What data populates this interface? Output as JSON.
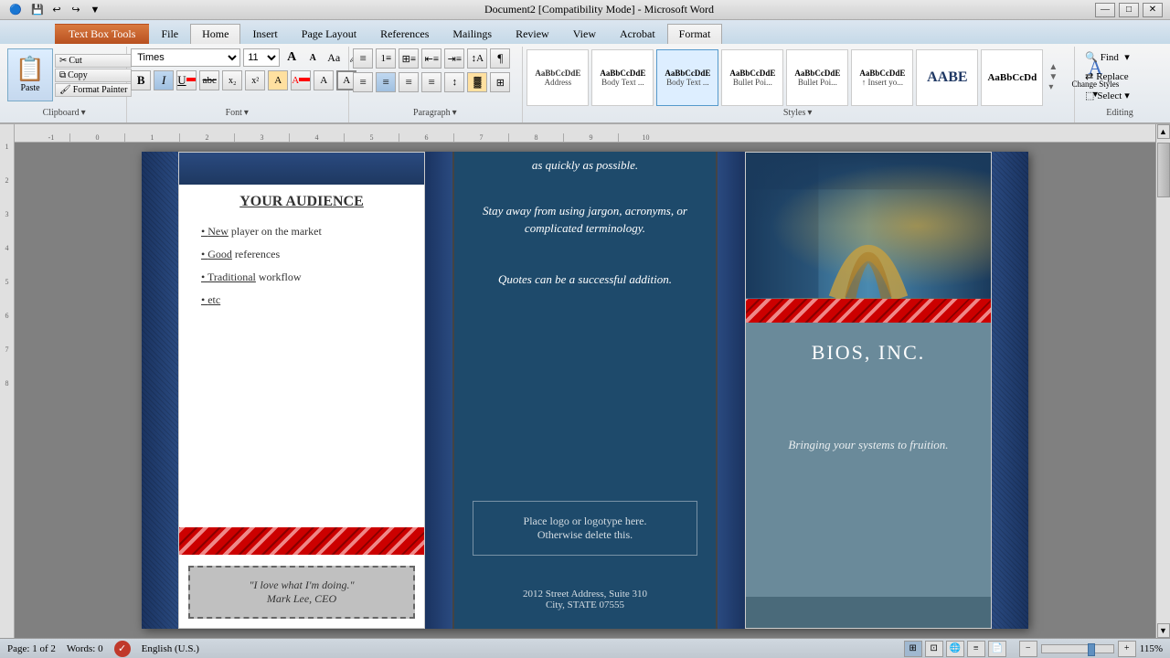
{
  "titlebar": {
    "title": "Document2 [Compatibility Mode] - Microsoft Word",
    "quickaccess": [
      "💾",
      "↩",
      "↪",
      "⬛"
    ],
    "winbtns": [
      "—",
      "□",
      "✕"
    ]
  },
  "ribbon": {
    "textboxtoolslabel": "Text Box Tools",
    "tabs": [
      {
        "id": "file",
        "label": "File"
      },
      {
        "id": "home",
        "label": "Home",
        "active": true
      },
      {
        "id": "insert",
        "label": "Insert"
      },
      {
        "id": "pagelayout",
        "label": "Page Layout"
      },
      {
        "id": "references",
        "label": "References"
      },
      {
        "id": "mailings",
        "label": "Mailings"
      },
      {
        "id": "review",
        "label": "Review"
      },
      {
        "id": "view",
        "label": "View"
      },
      {
        "id": "acrobat",
        "label": "Acrobat"
      },
      {
        "id": "format",
        "label": "Format",
        "formatactive": true
      }
    ],
    "clipboard": {
      "label": "Clipboard",
      "paste_label": "Paste",
      "cut_label": "Cut",
      "copy_label": "Copy",
      "format_painter_label": "Format Painter"
    },
    "font": {
      "label": "Font",
      "font_name": "Times",
      "font_size": "11",
      "bold": "B",
      "italic": "I",
      "underline": "U",
      "strikethrough": "abc",
      "subscript": "x₂",
      "superscript": "x²"
    },
    "paragraph": {
      "label": "Paragraph"
    },
    "styles": {
      "label": "Styles",
      "items": [
        {
          "id": "address",
          "preview": "AaBbCcDdE",
          "label": "Address"
        },
        {
          "id": "bodytext1",
          "preview": "AaBbCcDdE",
          "label": "Body Text ..."
        },
        {
          "id": "bodytext2",
          "preview": "AaBbCcDdE",
          "label": "Body Text ..."
        },
        {
          "id": "bulletpoin1",
          "preview": "AaBbCcDdE",
          "label": "Bullet Poi..."
        },
        {
          "id": "bulletpoin2",
          "preview": "AaBbCcDdE",
          "label": "Bullet Poi..."
        },
        {
          "id": "insertyour",
          "preview": "AaBbCcDdE",
          "label": "↑ Insert yo..."
        },
        {
          "id": "aabe",
          "preview": "AABE",
          "label": ""
        },
        {
          "id": "normal",
          "preview": "AaBbCcDd",
          "label": ""
        }
      ],
      "change_styles_label": "Change Styles",
      "selected_style": "Text , Body"
    },
    "editing": {
      "label": "Editing",
      "find_label": "Find",
      "replace_label": "Replace",
      "select_label": "Select"
    }
  },
  "ruler": {
    "marks": [
      "-1",
      "0",
      "1",
      "2",
      "3",
      "4",
      "5",
      "6",
      "7",
      "8",
      "9",
      "10"
    ]
  },
  "document": {
    "panel1": {
      "heading": "YOUR AUDIENCE",
      "bullets": [
        {
          "text": "New",
          "rest": " player on the market"
        },
        {
          "text": "Good",
          "rest": " references"
        },
        {
          "text": "Traditional",
          "rest": " workflow"
        },
        {
          "text": "etc",
          "rest": ""
        }
      ],
      "quote": "\"I love what I'm doing.\" Mark Lee, CEO"
    },
    "panel2": {
      "text1": "as quickly as possible.",
      "text2": "Stay away from using jargon, acronyms, or complicated terminology.",
      "text3": "Quotes can be a successful addition.",
      "logo_text": "Place logo  or logotype here.\nOtherwise delete this.",
      "address1": "2012 Street Address,  Suite 310",
      "address2": "City, STATE 07555"
    },
    "panel3": {
      "company": "BIOS, INC.",
      "tagline": "Bringing your systems to fruition."
    }
  },
  "statusbar": {
    "page_info": "Page: 1 of 2",
    "words": "Words: 0",
    "language": "English (U.S.)",
    "zoom": "115%"
  }
}
